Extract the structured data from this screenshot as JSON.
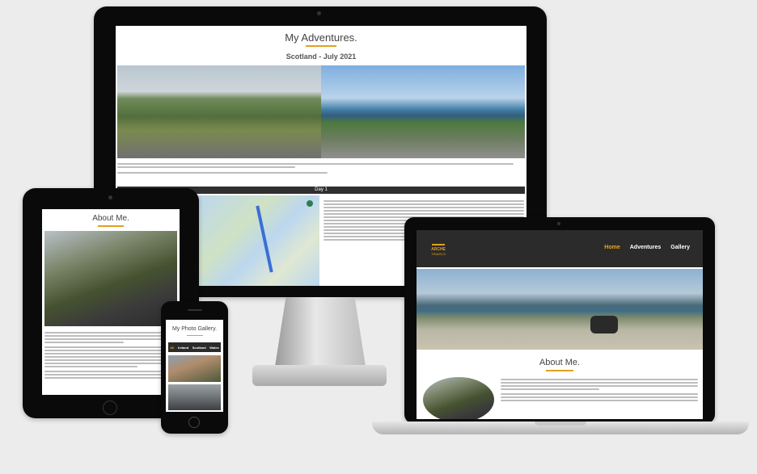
{
  "desktop": {
    "page_title": "My Adventures.",
    "subtitle": "Scotland - July 2021",
    "day_label": "Day 1"
  },
  "tablet": {
    "page_title": "About Me."
  },
  "phone": {
    "page_title": "My Photo Gallery.",
    "filters": [
      "All",
      "Ireland",
      "Scotland",
      "Wales"
    ]
  },
  "laptop": {
    "logo_top": "ARCHE",
    "logo_bottom": "TRAVELS",
    "nav": [
      "Home",
      "Adventures",
      "Gallery"
    ],
    "page_title": "About Me."
  },
  "colors": {
    "accent": "#e0a020",
    "nav_active": "#f0a51a",
    "navbar": "#2b2b2b",
    "day_bar": "#2f2f2f"
  }
}
